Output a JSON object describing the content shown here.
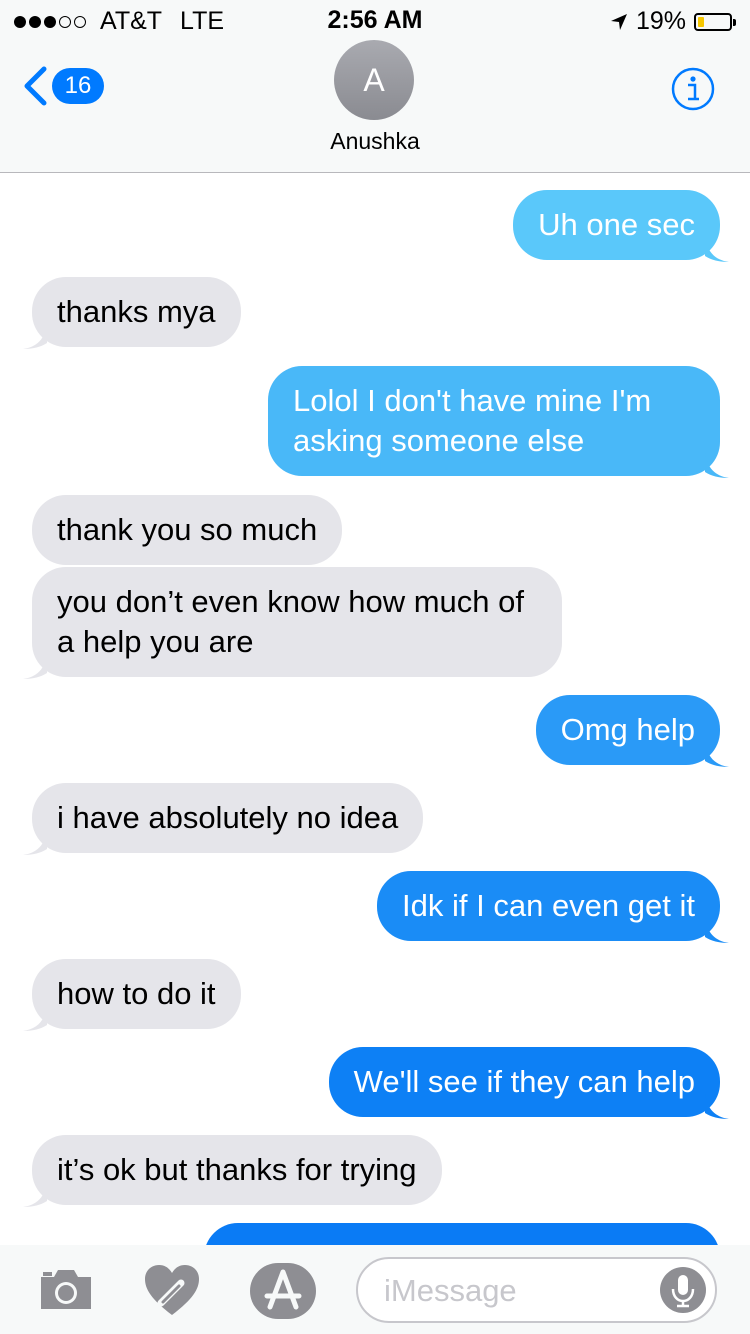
{
  "status": {
    "carrier": "AT&T",
    "network": "LTE",
    "time": "2:56 AM",
    "battery": "19%",
    "battery_level": 0.19,
    "signal_bars": 3,
    "signal_total": 5
  },
  "nav": {
    "unread_count": "16",
    "avatar_initial": "A",
    "contact_name": "Anushka"
  },
  "messages": [
    {
      "dir": "out",
      "text": "Uh one sec",
      "color": "#5ac8fa"
    },
    {
      "dir": "in",
      "text": "thanks mya"
    },
    {
      "dir": "out",
      "text": "Lolol I don't have mine I'm asking someone else",
      "color": "#49b8f8"
    },
    {
      "dir": "in",
      "text": "thank you so much"
    },
    {
      "dir": "in",
      "text": "you don’t even know how much of a help you are"
    },
    {
      "dir": "out",
      "text": "Omg help",
      "color": "#2a9af7"
    },
    {
      "dir": "in",
      "text": "i have absolutely no idea"
    },
    {
      "dir": "out",
      "text": "Idk if I can even get it",
      "color": "#1a8cf6"
    },
    {
      "dir": "in",
      "text": "how to do it"
    },
    {
      "dir": "out",
      "text": "We'll see if they can help",
      "color": "#0d80f5"
    },
    {
      "dir": "in",
      "text": "it’s ok but thanks for trying"
    },
    {
      "dir": "out",
      "text": "",
      "color": "#0a7bf5"
    }
  ],
  "input": {
    "placeholder": "iMessage"
  },
  "icons": [
    "chevron-left-icon",
    "info-icon",
    "camera-icon",
    "digital-touch-heart-icon",
    "app-store-icon",
    "microphone-icon"
  ],
  "colors": {
    "accent": "#007aff",
    "incoming_bubble": "#e5e5ea",
    "battery_fill": "#f6c700"
  }
}
